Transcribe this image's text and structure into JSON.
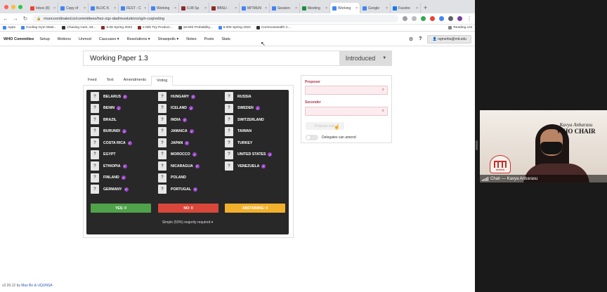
{
  "colors": {
    "yes": "#4fa24a",
    "no": "#d9473a",
    "abstain": "#f1b12c",
    "badge": "#9b45c9",
    "panel": "#282828",
    "accent": "#b0334a"
  },
  "browser": {
    "tabs": [
      {
        "label": "Inbox (8)",
        "color": "#ea4335"
      },
      {
        "label": "Copy of",
        "color": "#4285f4"
      },
      {
        "label": "BLOC K",
        "color": "#4285f4"
      },
      {
        "label": "FEST - C",
        "color": "#4285f4"
      },
      {
        "label": "Working",
        "color": "#4285f4"
      },
      {
        "label": "6.08 Sp",
        "color": "#8b2a2a"
      },
      {
        "label": "BBSU -",
        "color": "#8b2a2a"
      },
      {
        "label": "MITMUN",
        "color": "#4285f4"
      },
      {
        "label": "Session",
        "color": "#4285f4"
      },
      {
        "label": "Meeting",
        "color": "#1e8e3e"
      },
      {
        "label": "Working",
        "color": "#4285f4",
        "active": true
      },
      {
        "label": "Google",
        "color": "#4285f4"
      },
      {
        "label": "Facebo",
        "color": "#1877f2"
      }
    ],
    "url": "muncoordinated.io/committees/hez-zqz-dad/resolutions/qyh-csq/voting",
    "bookmarks": [
      {
        "label": "Apps",
        "color": "#4285f4"
      },
      {
        "label": "Cooling Gym Mast...",
        "color": "#4285f4"
      },
      {
        "label": "Chasing Cars, 63...",
        "color": "#333333"
      },
      {
        "label": "6.08 Spring 2022",
        "color": "#8b2a2a"
      },
      {
        "label": "2.00b Toy Product...",
        "color": "#8b2a2a"
      },
      {
        "label": "18.600 Probability...",
        "color": "#555555"
      },
      {
        "label": "6.005 Spring 2022",
        "color": "#4285f4"
      },
      {
        "label": "Commonwealth C...",
        "color": "#333333"
      }
    ],
    "reading_list": "Reading List"
  },
  "app": {
    "brand": "WHO Committee",
    "nav": [
      "Setup",
      "Motions",
      "Unmod",
      "Caucuses ▾",
      "Resolutions ▾",
      "Strawpolls ▾",
      "Notes",
      "Posts",
      "Stats"
    ],
    "user": "rajmehta@mit.edu",
    "title": "Working Paper 1.3",
    "status": "Introduced",
    "tabs": [
      "Feed",
      "Text",
      "Amendments",
      "Voting"
    ],
    "active_tab": "Voting",
    "vote_placeholder": "?",
    "countries": [
      {
        "name": "BELARUS",
        "badge": true
      },
      {
        "name": "BENIN",
        "badge": true
      },
      {
        "name": "BRAZIL",
        "badge": false
      },
      {
        "name": "BURUNDI",
        "badge": true
      },
      {
        "name": "COSTA RICA",
        "badge": true
      },
      {
        "name": "EGYPT",
        "badge": false
      },
      {
        "name": "ETHIOPIA",
        "badge": true
      },
      {
        "name": "FINLAND",
        "badge": true
      },
      {
        "name": "GERMANY",
        "badge": true
      },
      {
        "name": "HUNGARY",
        "badge": true
      },
      {
        "name": "ICELAND",
        "badge": true
      },
      {
        "name": "INDIA",
        "badge": true
      },
      {
        "name": "JAMAICA",
        "badge": true
      },
      {
        "name": "JAPAN",
        "badge": true
      },
      {
        "name": "MOROCCO",
        "badge": true
      },
      {
        "name": "NICARAGUA",
        "badge": true
      },
      {
        "name": "POLAND",
        "badge": false
      },
      {
        "name": "PORTUGAL",
        "badge": true
      },
      {
        "name": "RUSSIA",
        "badge": false
      },
      {
        "name": "SWEDEN",
        "badge": true
      },
      {
        "name": "SWITZERLAND",
        "badge": false
      },
      {
        "name": "TAIWAN",
        "badge": false
      },
      {
        "name": "TURKEY",
        "badge": false
      },
      {
        "name": "UNITED STATES",
        "badge": true
      },
      {
        "name": "VENEZUELA",
        "badge": true
      }
    ],
    "yes": "YES: 0",
    "no": "NO: 0",
    "abstain": "ABSTAINING: 0",
    "majority": "Simple (50%) majority required ▾",
    "proposer_label": "Proposer",
    "seconder_label": "Seconder",
    "propose_button": "Propose vote",
    "amend_label": "Delegates can amend",
    "footer_version": "v2.20.12 by",
    "footer_authors": "Max Bo & UQUNSA"
  },
  "video": {
    "chair_name": "Kavya Anbarasu",
    "chair_title": "WHO CHAIR",
    "seal_label": "MITMUN",
    "participant": "Chair — Kavya Anbarasu"
  }
}
